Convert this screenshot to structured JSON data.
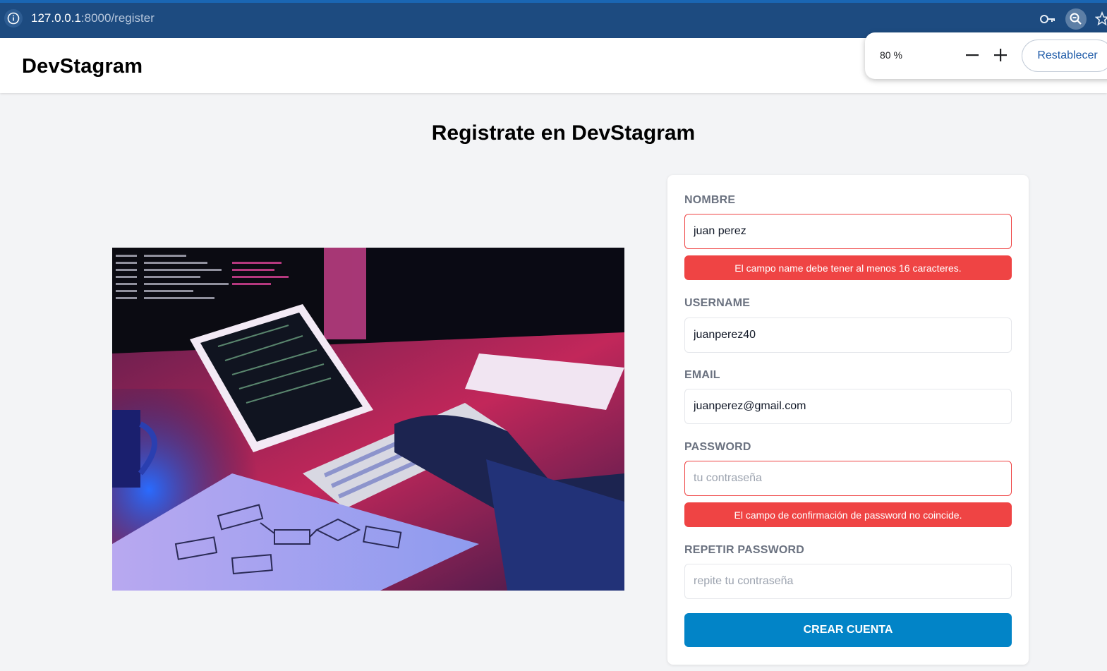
{
  "browser": {
    "url_host": "127.0.0.1",
    "url_path": ":8000/register",
    "icons": [
      "info-icon",
      "key-icon",
      "zoom-icon",
      "star-icon"
    ]
  },
  "zoom_popup": {
    "level": "80 %",
    "decrease": "−",
    "increase": "+",
    "reset_label": "Restablecer"
  },
  "header": {
    "logo": "DevStagram"
  },
  "main": {
    "title": "Registrate en DevStagram",
    "image_alt": "developer-working-illustration"
  },
  "form": {
    "name": {
      "label": "Nombre",
      "value": "juan perez",
      "error": "El campo name debe tener al menos 16 caracteres."
    },
    "username": {
      "label": "Username",
      "value": "juanperez40"
    },
    "email": {
      "label": "Email",
      "value": "juanperez@gmail.com"
    },
    "password": {
      "label": "Password",
      "placeholder": "tu contraseña",
      "error": "El campo de confirmación de password no coincide."
    },
    "password_confirm": {
      "label": "Repetir Password",
      "placeholder": "repite tu contraseña"
    },
    "submit_label": "Crear Cuenta"
  },
  "colors": {
    "browser_bar": "#1d4b80",
    "error": "#ef4444",
    "submit": "#0284c7"
  }
}
